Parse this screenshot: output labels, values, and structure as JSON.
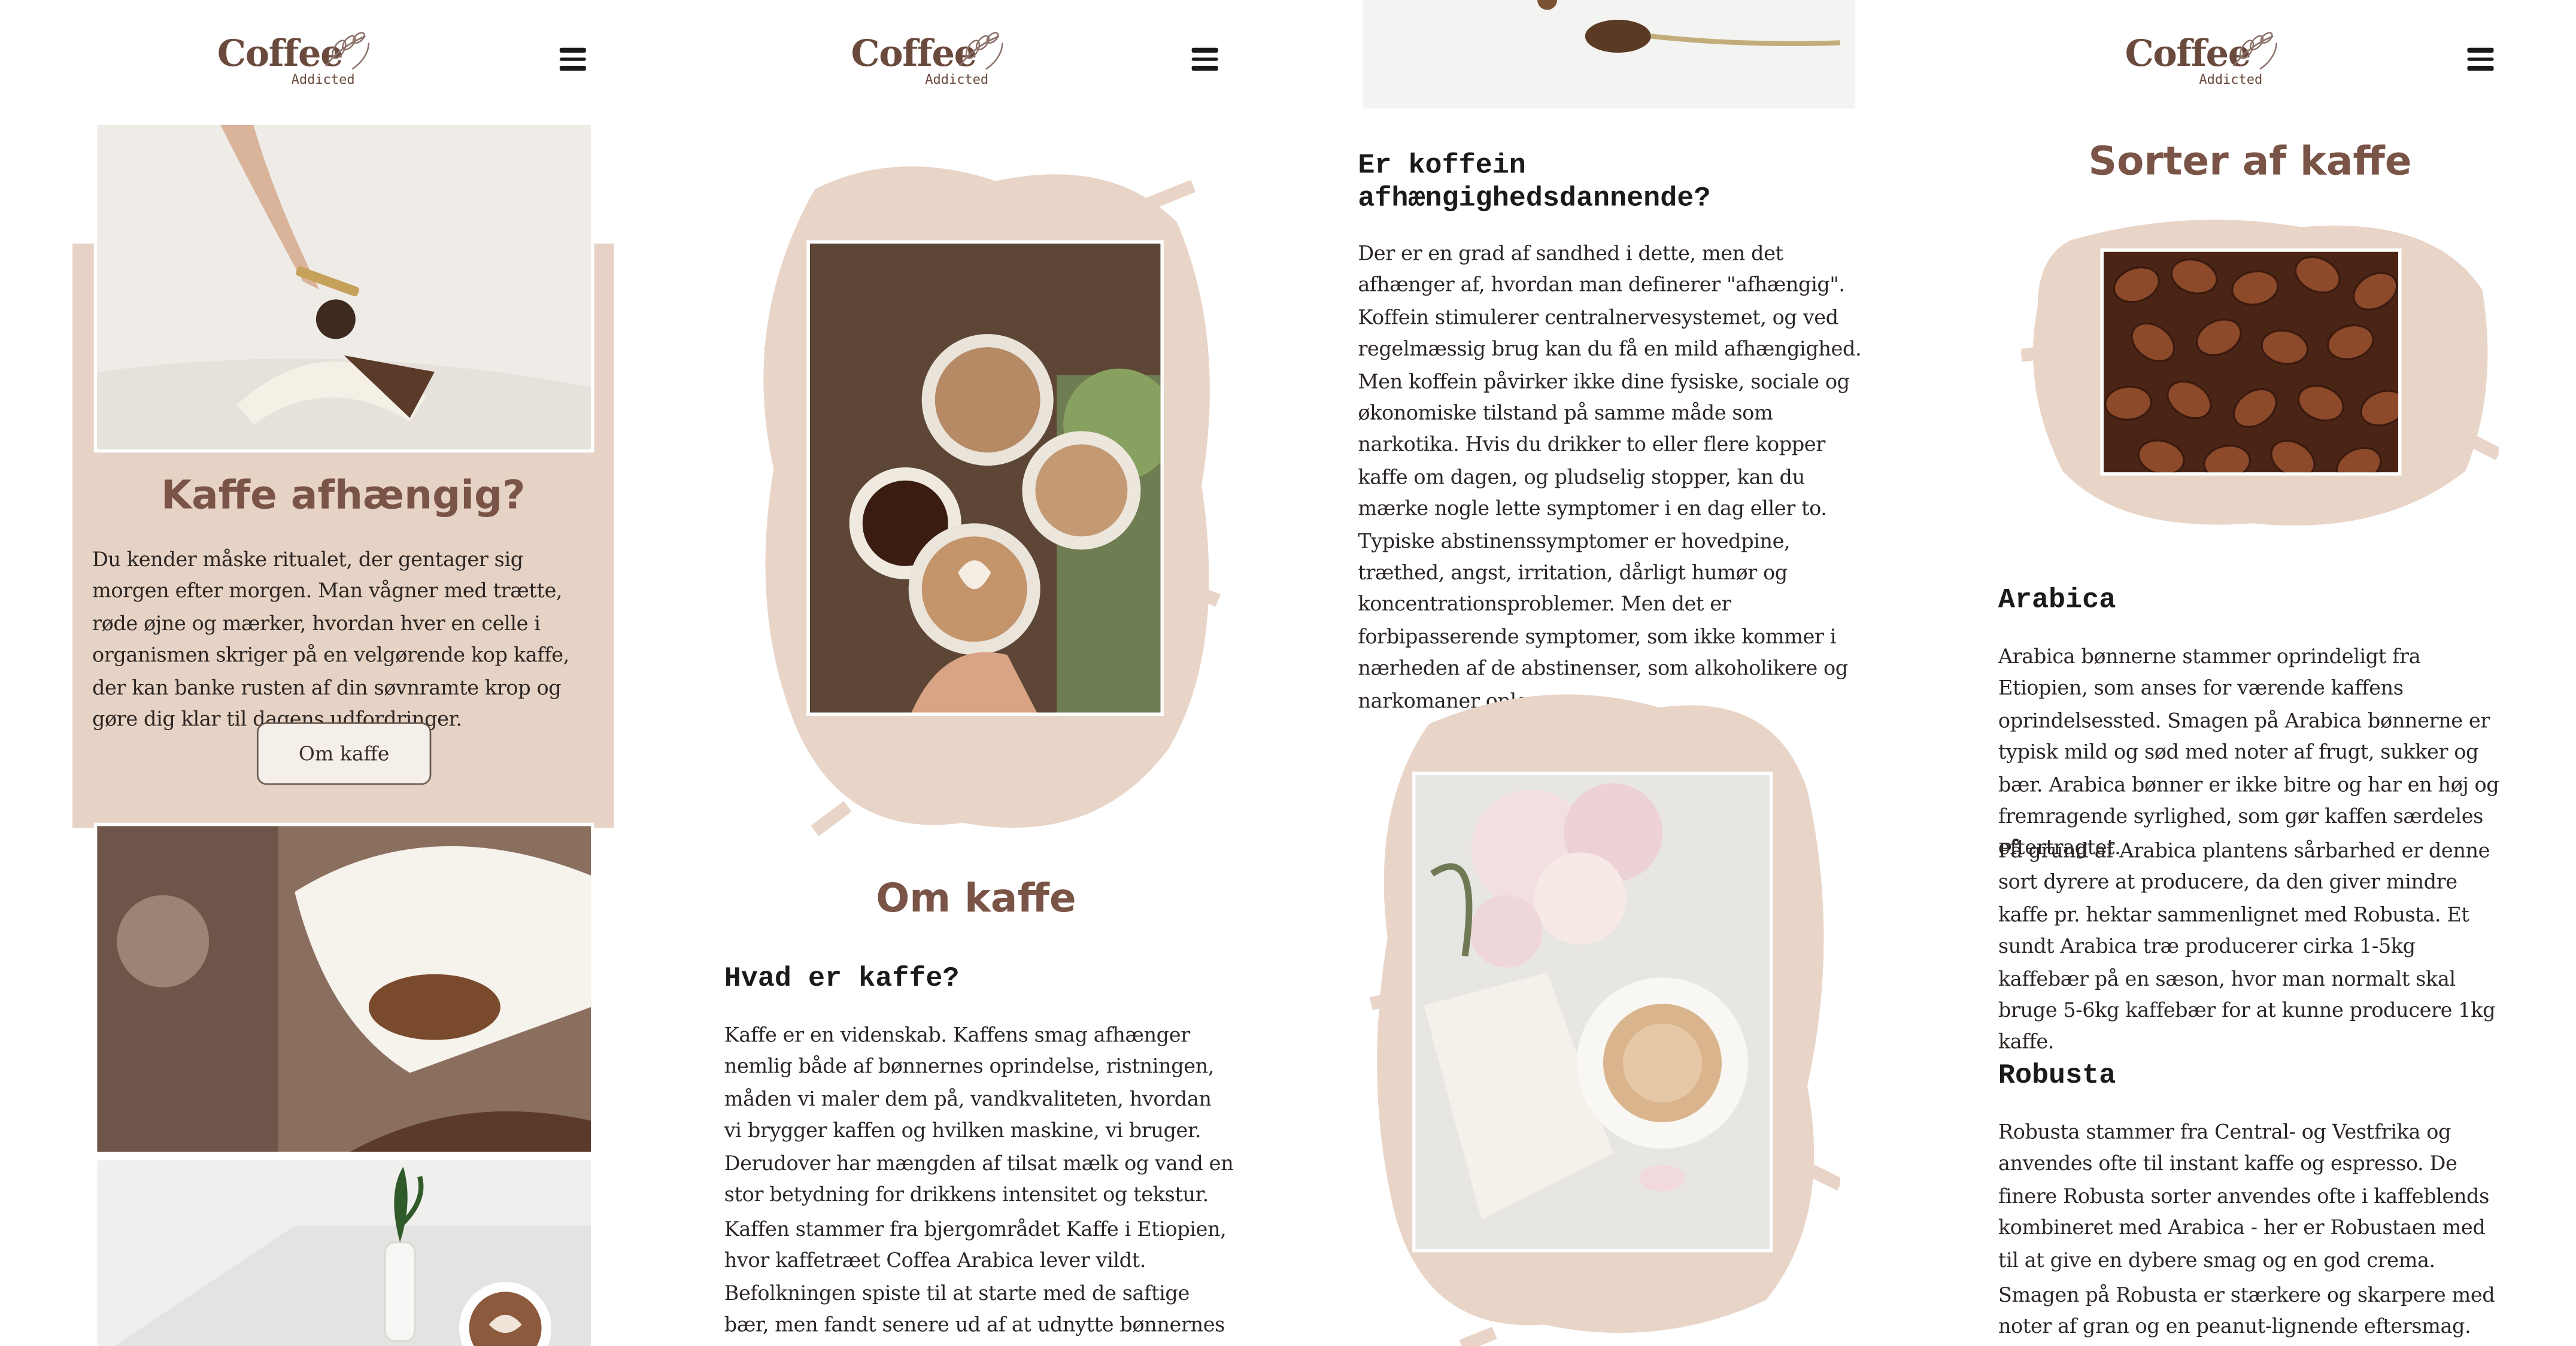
{
  "brand": {
    "name": "Coffee",
    "tagline": "Addicted"
  },
  "col1": {
    "title": "Kaffe afhængig?",
    "body": "Du kender måske ritualet, der gentager sig morgen efter morgen. Man vågner med trætte, røde øjne og mærker, hvordan hver en celle i organismen skriger på en velgørende kop kaffe, der kan banke rusten af din søvnramte krop og gøre dig klar til dagens udfordringer.",
    "button": "Om kaffe"
  },
  "col2": {
    "title": "Om kaffe",
    "subtitle": "Hvad er kaffe?",
    "p1": "Kaffe er en videnskab. Kaffens smag afhænger nemlig både af bønnernes oprindelse, ristningen, måden vi maler dem på, vandkvaliteten, hvordan vi brygger kaffen og hvilken maskine, vi bruger. Derudover har mængden af tilsat mælk og vand en stor betydning for drikkens intensitet og tekstur.",
    "p2": "Kaffen stammer fra bjergområdet Kaffe i Etiopien, hvor kaffetræet Coffea Arabica lever vildt. Befolkningen spiste til at starte med de saftige bær, men fandt senere ud af at udnytte bønnernes aromatiske smag."
  },
  "col3": {
    "subtitle": "Er koffein afhængighedsdannende?",
    "body": "Der er en grad af sandhed i dette, men det afhænger af, hvordan man definerer \"afhængig\". Koffein stimulerer centralnervesystemet, og ved regelmæssig brug kan du få en mild afhængighed. Men koffein påvirker ikke dine fysiske, sociale og økonomiske tilstand på samme måde som narkotika. Hvis du drikker to eller flere kopper kaffe om dagen, og pludselig stopper, kan du mærke nogle lette symptomer i en dag eller to. Typiske abstinenssymptomer er hovedpine, træthed, angst, irritation, dårligt humør og koncentrationsproblemer. Men det er forbipasserende symptomer, som ikke kommer i nærheden af de abstinenser, som alkoholikere og narkomaner oplever."
  },
  "col4": {
    "title": "Sorter af kaffe",
    "arabica_title": "Arabica",
    "arabica_p1": "Arabica bønnerne stammer oprindeligt fra Etiopien, som anses for værende kaffens oprindelsessted. Smagen på Arabica bønnerne er typisk mild og sød med noter af frugt, sukker og bær. Arabica bønner er ikke bitre og har en høj og fremragende syrlighed, som gør kaffen særdeles eftertragtet.",
    "arabica_p2": "På grund af Arabica plantens sårbarhed er denne sort dyrere at producere, da den giver mindre kaffe pr. hektar sammenlignet med Robusta. Et sundt Arabica træ producerer cirka 1-5kg kaffebær på en sæson, hvor man normalt skal bruge 5-6kg kaffebær for at kunne producere 1kg kaffe.",
    "robusta_title": "Robusta",
    "robusta_p1": "Robusta stammer fra Central- og Vestfrika og anvendes ofte til instant kaffe og espresso. De finere Robusta sorter anvendes ofte i kaffeblends kombineret med Arabica - her er Robustaen med til at give en dybere smag og en god crema.",
    "robusta_p2": "Smagen på Robusta er stærkere og skarpere med noter af gran og en peanut-lignende eftersmag. Bønnerne"
  },
  "colors": {
    "accent": "#7a5446",
    "blush": "#e6d2c4",
    "text": "#2b2523"
  },
  "icons": [
    "coffee-leaf-icon",
    "hamburger-menu-icon"
  ]
}
